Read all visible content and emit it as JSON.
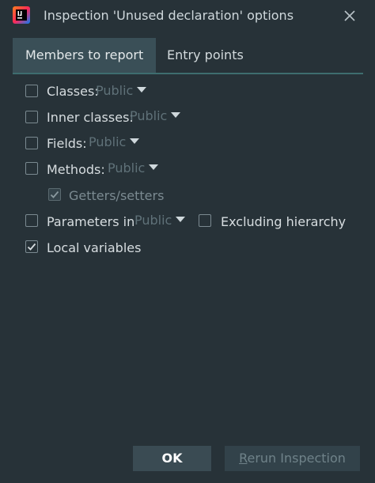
{
  "window": {
    "title": "Inspection 'Unused declaration' options",
    "app_icon": "intellij-idea-icon",
    "close_icon": "close-icon"
  },
  "tabs": [
    {
      "label": "Members to report",
      "active": true
    },
    {
      "label": "Entry points",
      "active": false
    }
  ],
  "members": {
    "classes": {
      "label": "Classes:",
      "checked": false,
      "visibility": "Public"
    },
    "inner_classes": {
      "label": "Inner classes:",
      "checked": false,
      "visibility": "Public"
    },
    "fields": {
      "label": "Fields:",
      "checked": false,
      "visibility": "Public"
    },
    "methods": {
      "label": "Methods:",
      "checked": false,
      "visibility": "Public"
    },
    "getters_setters": {
      "label": "Getters/setters",
      "checked": true,
      "disabled": true
    },
    "parameters": {
      "label": "Parameters in",
      "checked": false,
      "visibility": "Public"
    },
    "excluding_hierarchy": {
      "label": "Excluding hierarchy",
      "checked": false
    },
    "local_variables": {
      "label": "Local variables",
      "checked": true
    }
  },
  "buttons": {
    "ok": "OK",
    "rerun_first": "R",
    "rerun_rest": "erun Inspection"
  }
}
